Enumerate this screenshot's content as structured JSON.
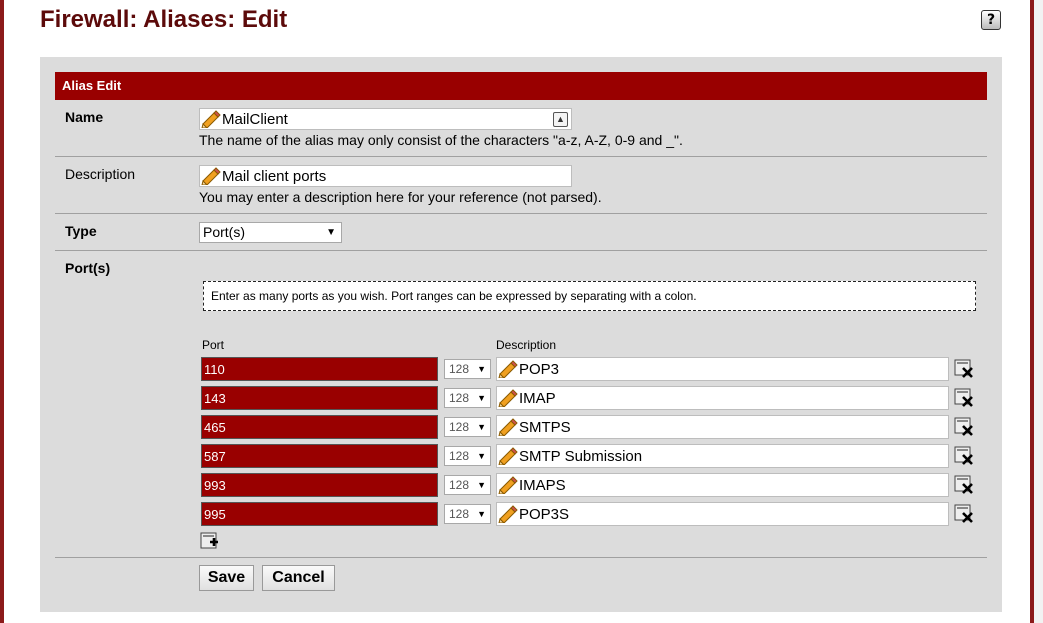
{
  "page": {
    "title": "Firewall: Aliases: Edit",
    "help_icon": "?"
  },
  "panel": {
    "header": "Alias Edit"
  },
  "name": {
    "label": "Name",
    "value": "MailClient",
    "help": "The name of the alias may only consist of the characters \"a-z, A-Z, 0-9 and _\"."
  },
  "description": {
    "label": "Description",
    "value": "Mail client ports",
    "help": "You may enter a description here for your reference (not parsed)."
  },
  "type": {
    "label": "Type",
    "selected": "Port(s)"
  },
  "ports": {
    "label": "Port(s)",
    "info": "Enter as many ports as you wish. Port ranges can be expressed by separating with a colon.",
    "col_port": "Port",
    "col_description": "Description",
    "rows": [
      {
        "port": "110",
        "mask": "128",
        "description": "POP3"
      },
      {
        "port": "143",
        "mask": "128",
        "description": "IMAP"
      },
      {
        "port": "465",
        "mask": "128",
        "description": "SMTPS"
      },
      {
        "port": "587",
        "mask": "128",
        "description": "SMTP Submission"
      },
      {
        "port": "993",
        "mask": "128",
        "description": "IMAPS"
      },
      {
        "port": "995",
        "mask": "128",
        "description": "POP3S"
      }
    ]
  },
  "buttons": {
    "save": "Save",
    "cancel": "Cancel"
  },
  "colors": {
    "accent": "#990000",
    "title": "#5c0a0a",
    "panel_bg": "#dcdcdc"
  }
}
